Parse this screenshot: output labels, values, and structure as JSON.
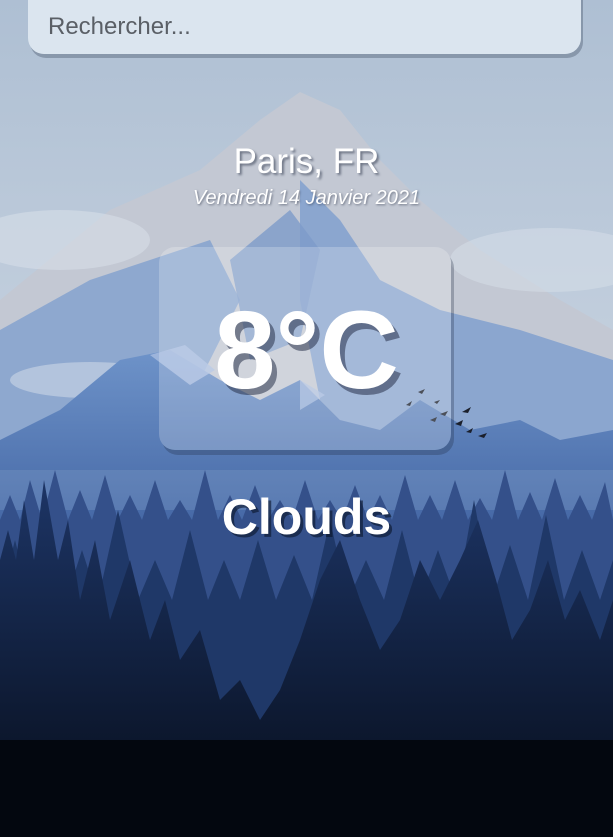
{
  "search": {
    "placeholder": "Rechercher..."
  },
  "weather": {
    "location": "Paris, FR",
    "date": "Vendredi 14 Janvier 2021",
    "temperature": "8°C",
    "condition": "Clouds"
  },
  "colors": {
    "sky_top": "#bccadb",
    "mountain_snow": "#c9cdd6",
    "mountain_blue": "#5d82bd",
    "forest_dark": "#0d1a33",
    "text": "#ffffff"
  }
}
